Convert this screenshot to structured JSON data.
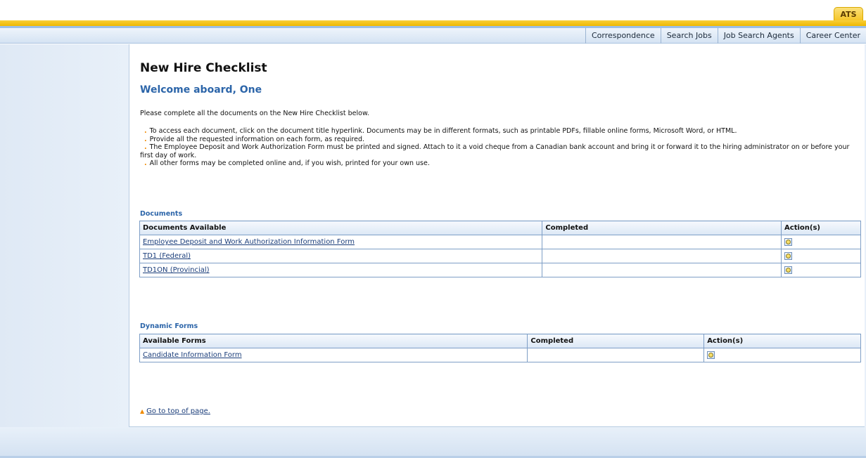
{
  "header": {
    "app_tab": "ATS"
  },
  "nav": {
    "items": [
      "Correspondence",
      "Search Jobs",
      "Job Search Agents",
      "Career Center"
    ]
  },
  "page": {
    "title": "New Hire Checklist",
    "welcome": "Welcome aboard, One",
    "intro": "Please complete all the documents on the New Hire Checklist below.",
    "bullets": [
      "To access each document, click on the document title hyperlink. Documents may be in different formats, such as printable PDFs, fillable online forms, Microsoft Word, or HTML.",
      "Provide all the requested information on each form, as required.",
      "The Employee Deposit and Work Authorization Form must be printed and signed. Attach to it a void cheque from a Canadian bank account and bring it or forward it to the hiring administrator on or before your first day of work.",
      "All other forms may be completed online and, if you wish, printed for your own use."
    ]
  },
  "documents": {
    "section_label": "Documents",
    "headers": [
      "Documents Available",
      "Completed",
      "Action(s)"
    ],
    "rows": [
      {
        "name": "Employee Deposit and Work Authorization Information Form",
        "completed": ""
      },
      {
        "name": "TD1 (Federal)",
        "completed": ""
      },
      {
        "name": "TD1ON (Provincial)",
        "completed": ""
      }
    ]
  },
  "dynamic_forms": {
    "section_label": "Dynamic Forms",
    "headers": [
      "Available Forms",
      "Completed",
      "Action(s)"
    ],
    "rows": [
      {
        "name": "Candidate Information Form",
        "completed": ""
      }
    ]
  },
  "footer": {
    "top_link": "Go to top of page."
  },
  "icons": {
    "view": "view-document-icon",
    "arrow": "up-arrow-icon"
  },
  "colors": {
    "accent_gold": "#f4c21c",
    "heading_blue": "#2c65a9",
    "link": "#1a3d7a"
  }
}
